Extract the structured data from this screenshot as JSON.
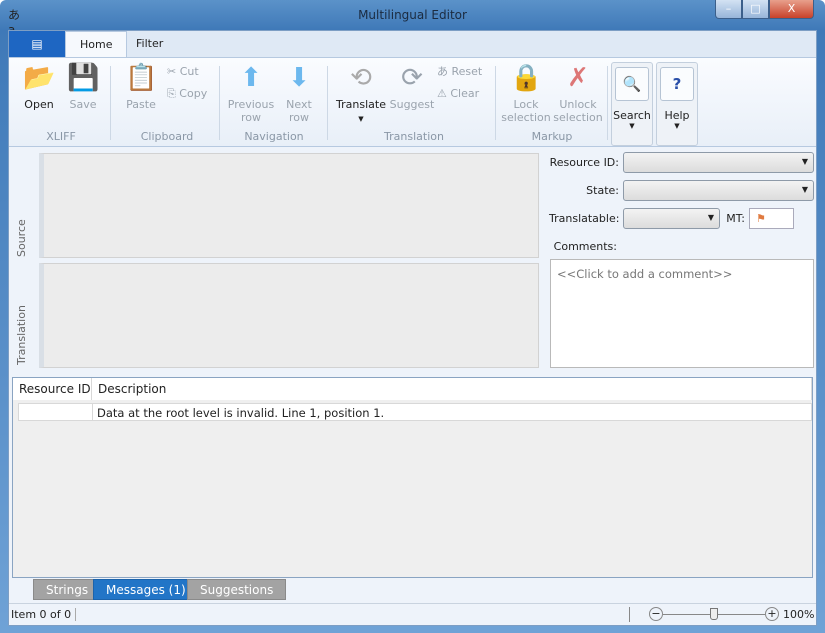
{
  "window": {
    "title": "Multilingual Editor",
    "app_icon": "あa",
    "minimize": "–",
    "maximize": "□",
    "close": "X"
  },
  "ribbon": {
    "app_menu_icon": "app-menu-icon",
    "tabs": [
      {
        "label": "Home",
        "active": true
      },
      {
        "label": "Filter",
        "active": false
      }
    ],
    "groups": {
      "xliff": {
        "label": "XLIFF",
        "open": "Open",
        "save": "Save"
      },
      "clipboard": {
        "label": "Clipboard",
        "paste": "Paste",
        "cut": "Cut",
        "copy": "Copy"
      },
      "navigation": {
        "label": "Navigation",
        "previous_row": "Previous row",
        "next_row": "Next row"
      },
      "translation": {
        "label": "Translation",
        "translate": "Translate",
        "suggest": "Suggest",
        "reset": "Reset",
        "clear": "Clear"
      },
      "markup": {
        "label": "Markup",
        "lock": "Lock selection",
        "unlock": "Unlock selection"
      },
      "search": "Search",
      "help": "Help"
    }
  },
  "editor": {
    "source_label": "Source",
    "translation_label": "Translation"
  },
  "properties": {
    "resource_id_label": "Resource ID:",
    "resource_id_value": "",
    "state_label": "State:",
    "state_value": "",
    "translatable_label": "Translatable:",
    "translatable_value": "",
    "mt_label": "MT:",
    "comments_label": "Comments:",
    "comments_placeholder": "<<Click to add a comment>>"
  },
  "messages": {
    "columns": [
      "Resource ID",
      "Description"
    ],
    "rows": [
      {
        "resource_id": "",
        "description": "Data at the root level is invalid. Line 1, position 1."
      }
    ]
  },
  "bottom_tabs": [
    {
      "label": "Strings",
      "active": false
    },
    {
      "label": "Messages (1)",
      "active": true
    },
    {
      "label": "Suggestions",
      "active": false
    }
  ],
  "status": {
    "item": "Item 0 of 0",
    "zoom": "100%",
    "zoom_fraction": 0.5
  }
}
